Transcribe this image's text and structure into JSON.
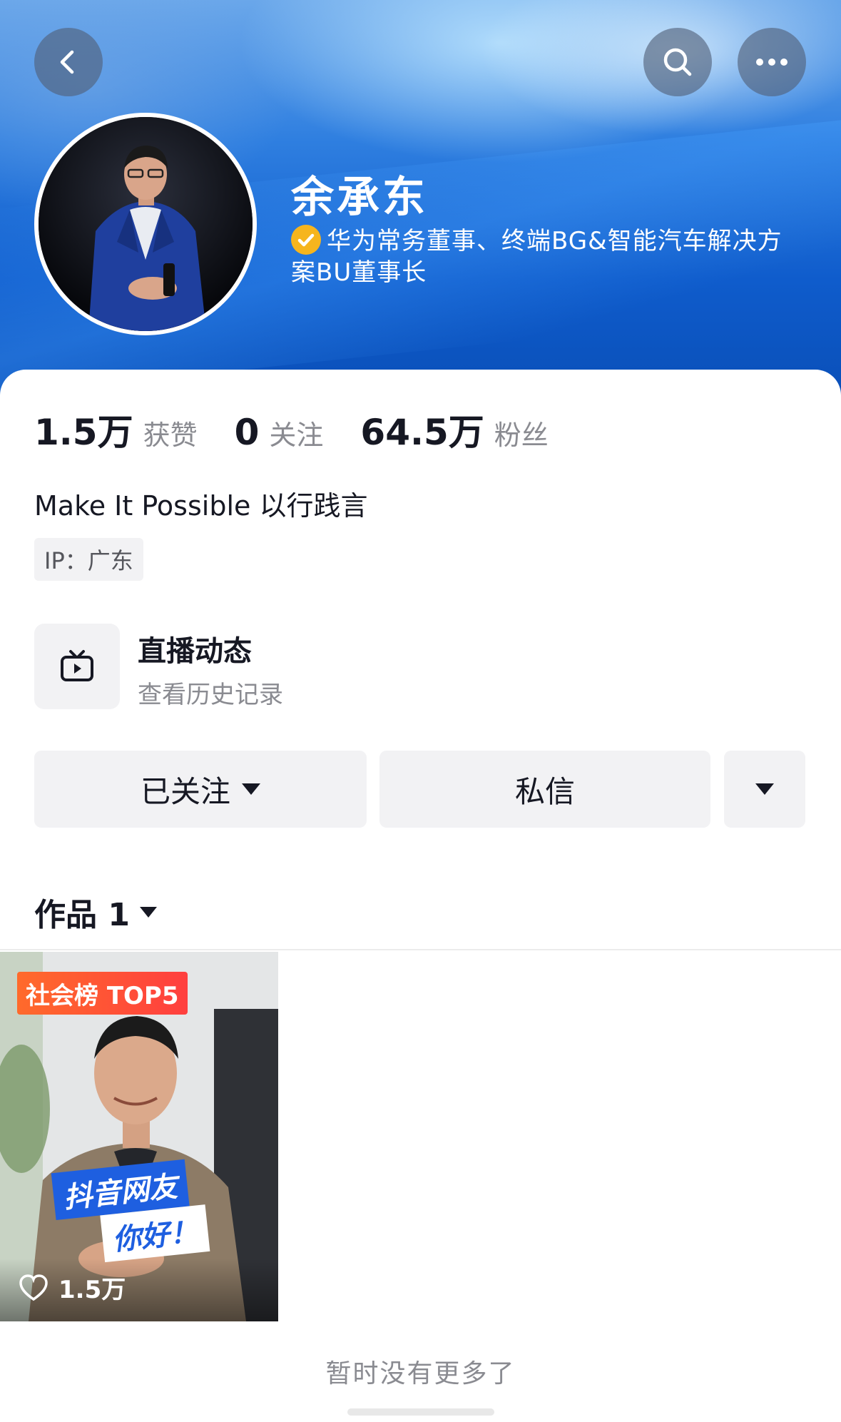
{
  "header": {
    "back_icon": "chevron-left-icon",
    "search_icon": "search-icon",
    "more_icon": "more-dots-icon"
  },
  "profile": {
    "name": "余承东",
    "verified_icon": "verified-check-icon",
    "verified_color": "#f6b51e",
    "verification_text": "华为常务董事、终端BG&智能汽车解决方案BU董事长"
  },
  "stats": [
    {
      "value": "1.5万",
      "label": "获赞"
    },
    {
      "value": "0",
      "label": "关注"
    },
    {
      "value": "64.5万",
      "label": "粉丝"
    }
  ],
  "bio": "Make It Possible 以行践言",
  "ip_location": "IP：广东",
  "live": {
    "icon": "tv-live-icon",
    "title": "直播动态",
    "subtitle": "查看历史记录"
  },
  "actions": {
    "follow_label": "已关注",
    "message_label": "私信"
  },
  "works": {
    "tab_label": "作品 1",
    "items": [
      {
        "badge": "社会榜 TOP5",
        "banner_line1": "抖音网友",
        "banner_line2": "你好！",
        "likes": "1.5万"
      }
    ]
  },
  "footer": {
    "no_more_text": "暂时没有更多了"
  },
  "colors": {
    "hero_blue": "#0f5ccc",
    "badge_orange": "#ff5a2e",
    "banner_blue": "#1e5fe0"
  }
}
